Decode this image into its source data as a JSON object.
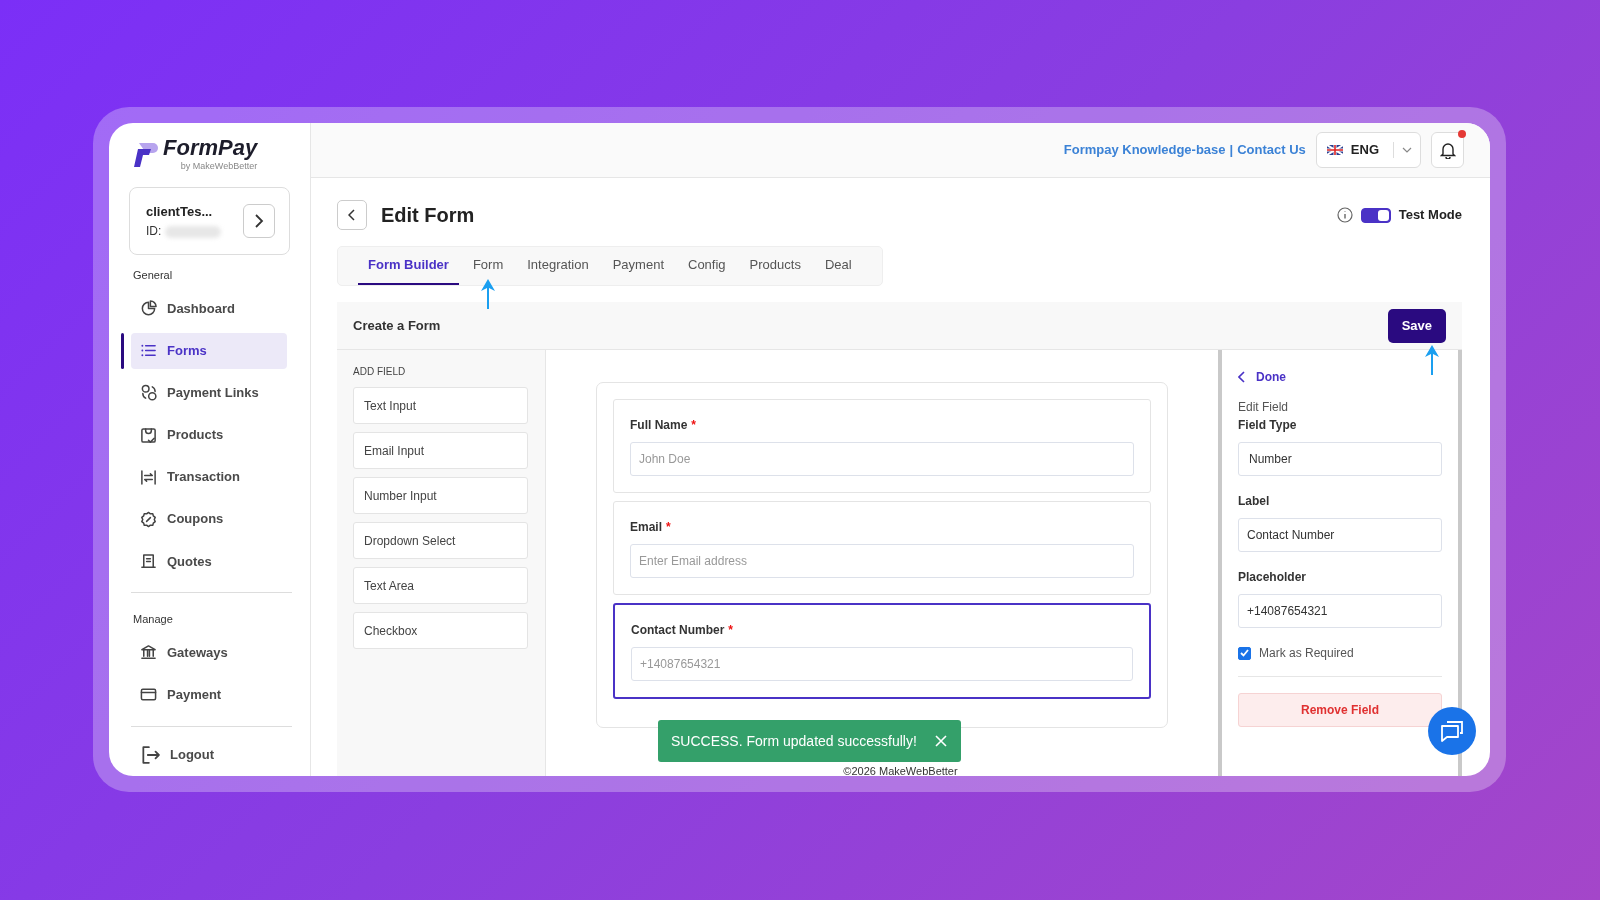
{
  "brand": {
    "name": "FormPay",
    "tagline": "by MakeWebBetter"
  },
  "account": {
    "name": "clientTes...",
    "id_label": "ID:"
  },
  "sidebar": {
    "sections": [
      {
        "heading": "General",
        "items": [
          {
            "label": "Dashboard",
            "selected": false
          },
          {
            "label": "Forms",
            "selected": true
          },
          {
            "label": "Payment Links",
            "selected": false
          },
          {
            "label": "Products",
            "selected": false
          },
          {
            "label": "Transaction",
            "selected": false
          },
          {
            "label": "Coupons",
            "selected": false
          },
          {
            "label": "Quotes",
            "selected": false
          }
        ]
      },
      {
        "heading": "Manage",
        "items": [
          {
            "label": "Gateways",
            "selected": false
          },
          {
            "label": "Payment",
            "selected": false
          }
        ]
      }
    ],
    "logout": "Logout"
  },
  "header": {
    "links": [
      "Formpay Knowledge-base",
      "Contact Us"
    ],
    "separator": "|",
    "language": "ENG",
    "unread_notifications": true
  },
  "page": {
    "title": "Edit Form",
    "test_mode": {
      "label": "Test Mode",
      "on": true
    }
  },
  "tabs": [
    {
      "label": "Form Builder",
      "selected": true
    },
    {
      "label": "Form",
      "selected": false
    },
    {
      "label": "Integration",
      "selected": false
    },
    {
      "label": "Payment",
      "selected": false
    },
    {
      "label": "Config",
      "selected": false
    },
    {
      "label": "Products",
      "selected": false
    },
    {
      "label": "Deal",
      "selected": false
    }
  ],
  "builder": {
    "title": "Create a Form",
    "save": "Save",
    "add_field_heading": "ADD FIELD",
    "field_types": [
      "Text Input",
      "Email Input",
      "Number Input",
      "Dropdown Select",
      "Text Area",
      "Checkbox"
    ],
    "fields": [
      {
        "label": "Full Name",
        "required_mark": "*",
        "placeholder": "John Doe",
        "selected": false
      },
      {
        "label": "Email",
        "required_mark": "*",
        "placeholder": "Enter Email address",
        "selected": false
      },
      {
        "label": "Contact Number",
        "required_mark": "*",
        "placeholder": "+14087654321",
        "selected": true
      }
    ],
    "editor": {
      "back": "Done",
      "heading": "Edit Field",
      "field_type_label": "Field Type",
      "field_type": "Number",
      "label_label": "Label",
      "label_value": "Contact Number",
      "placeholder_label": "Placeholder",
      "placeholder_input": {
        "value": "+14087654321"
      },
      "required": {
        "label": "Mark as Required",
        "checked": true
      },
      "remove": "Remove Field"
    }
  },
  "toast": {
    "kind": "success",
    "message": "SUCCESS. Form updated successfully!"
  },
  "footer": "©2026 MakeWebBetter"
}
